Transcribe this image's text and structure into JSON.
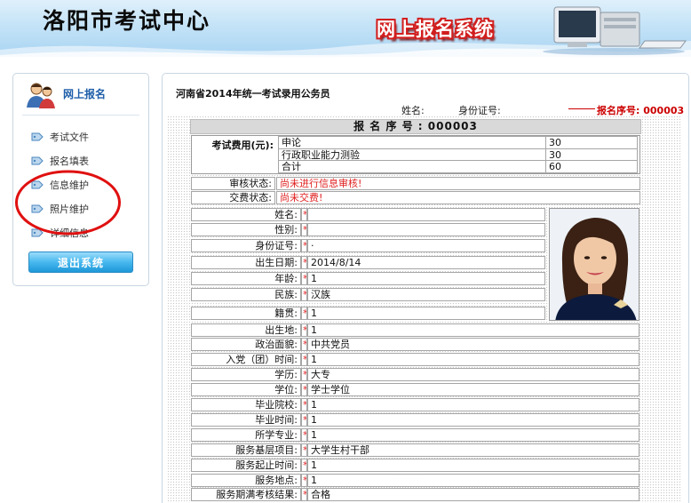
{
  "header": {
    "site_title": "洛阳市考试中心",
    "system_title": "网上报名系统"
  },
  "sidebar": {
    "title": "网上报名",
    "items": [
      {
        "label": "考试文件"
      },
      {
        "label": "报名填表"
      },
      {
        "label": "信息维护"
      },
      {
        "label": "照片维护"
      },
      {
        "label": "详细信息"
      }
    ],
    "logout_label": "退出系统"
  },
  "main": {
    "exam_title": "河南省2014年统一考试录用公务员",
    "name_label": "姓名:",
    "id_label": "身份证号:",
    "reg_no_label": "报名序号:",
    "reg_no": "000003",
    "reg_bar": "报 名 序 号 : 000003",
    "fee": {
      "label": "考试费用(元):",
      "rows": [
        {
          "name": "申论",
          "amount": "30"
        },
        {
          "name": "行政职业能力测验",
          "amount": "30"
        },
        {
          "name": "合计",
          "amount": "60"
        }
      ]
    },
    "audit": {
      "label": "审核状态:",
      "value": "尚未进行信息审核!"
    },
    "payment": {
      "label": "交费状态:",
      "value": "尚未交费!"
    },
    "fields": [
      {
        "label": "姓名:",
        "value": ""
      },
      {
        "label": "性别:",
        "value": ""
      },
      {
        "label": "身份证号:",
        "value": "·"
      },
      {
        "label": "出生日期:",
        "value": "2014/8/14"
      },
      {
        "label": "年龄:",
        "value": "1"
      },
      {
        "label": "民族:",
        "value": "汉族"
      },
      {
        "label": "籍贯:",
        "value": "1"
      },
      {
        "label": "出生地:",
        "value": "1"
      },
      {
        "label": "政治面貌:",
        "value": "中共党员"
      },
      {
        "label": "入党（团）时间:",
        "value": "1"
      },
      {
        "label": "学历:",
        "value": "大专"
      },
      {
        "label": "学位:",
        "value": "学士学位"
      },
      {
        "label": "毕业院校:",
        "value": "1"
      },
      {
        "label": "毕业时间:",
        "value": "1"
      },
      {
        "label": "所学专业:",
        "value": "1"
      },
      {
        "label": "服务基层项目:",
        "value": "大学生村干部"
      },
      {
        "label": "服务起止时间:",
        "value": "1"
      },
      {
        "label": "服务地点:",
        "value": "1"
      },
      {
        "label": "服务期满考核结果:",
        "value": "合格"
      }
    ],
    "required_mark": "*"
  },
  "colors": {
    "accent": "#1f5faa",
    "warning": "#e02020",
    "header_sky": "#c4e3f7"
  }
}
